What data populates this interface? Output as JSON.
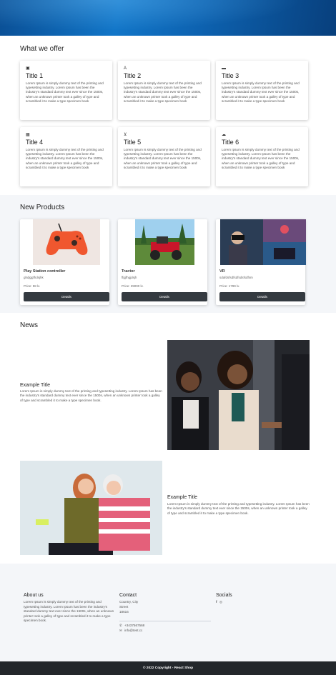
{
  "offer": {
    "heading": "What we offer",
    "cards": [
      {
        "icon": "book-icon",
        "glyph": "▣",
        "title": "Title 1",
        "text": "Lorem Ipsum is simply dummy text of the printing and typesetting industry. Lorem Ipsum has been the industry's standard dummy text ever since the 1500s, when an unknown printer took a galley of type and scrambled it to make a type specimen book"
      },
      {
        "icon": "language-icon",
        "glyph": "A",
        "title": "Title 2",
        "text": "Lorem Ipsum is simply dummy text of the printing and typesetting industry. Lorem Ipsum has been the industry's standard dummy text ever since the 1500s, when an unknown printer took a galley of type and scrambled it to make a type specimen book"
      },
      {
        "icon": "car-icon",
        "glyph": "▬",
        "title": "Title 3",
        "text": "Lorem Ipsum is simply dummy text of the printing and typesetting industry. Lorem Ipsum has been the industry's standard dummy text ever since the 1500s, when an unknown printer took a galley of type and scrambled it to make a type specimen book"
      },
      {
        "icon": "calendar-icon",
        "glyph": "▦",
        "title": "Title 4",
        "text": "Lorem Ipsum is simply dummy text of the printing and typesetting industry. Lorem Ipsum has been the industry's standard dummy text ever since the 1500s, when an unknown printer took a galley of type and scrambled it to make a type specimen book"
      },
      {
        "icon": "cart-icon",
        "glyph": "⊻",
        "title": "Title 5",
        "text": "Lorem Ipsum is simply dummy text of the printing and typesetting industry. Lorem Ipsum has been the industry's standard dummy text ever since the 1500s, when an unknown printer took a galley of type and scrambled it to make a type specimen book"
      },
      {
        "icon": "cloud-icon",
        "glyph": "☁",
        "title": "Title 6",
        "text": "Lorem Ipsum is simply dummy text of the printing and typesetting industry. Lorem Ipsum has been the industry's standard dummy text ever since the 1500s, when an unknown printer took a galley of type and scrambled it to make a type specimen book"
      }
    ]
  },
  "products": {
    "heading": "New Products",
    "items": [
      {
        "name": "Play Station controller",
        "desc": "ghdjggfhdsjhk",
        "price": "Price: 98 lv.",
        "button": "Details"
      },
      {
        "name": "Tractor",
        "desc": "ffgjfhgjdsjh",
        "price": "Price: 29000 lv.",
        "button": "Details"
      },
      {
        "name": "VR",
        "desc": "sdafdsfsdfsdfsdsfsdfsm",
        "price": "Price: 1799 lv.",
        "button": "Details"
      }
    ]
  },
  "news": {
    "heading": "News",
    "items": [
      {
        "title": "Example Title",
        "text": "Lorem Ipsum is simply dummy text of the printing and typesetting industry. Lorem Ipsum has been the industry's standard dummy text ever since the 1500s, when an unknown printer took a galley of type and scrambled it to make a type specimen book."
      },
      {
        "title": "Example Title",
        "text": "Lorem Ipsum is simply dummy text of the printing and typesetting industry. Lorem Ipsum has been the industry's standard dummy text ever since the 1500s, when an unknown printer took a galley of type and scrambled it to make a type specimen book."
      }
    ]
  },
  "footer": {
    "about_heading": "About us",
    "about_text": "Lorem Ipsum is simply dummy text of the printing and typesetting industry. Lorem Ipsum has been the industry's standard dummy text ever since the 1500s, when an unknown printer took a galley of type and scrambled it to make a type specimen book.",
    "contact_heading": "Contact",
    "address_line1": "Country, City",
    "address_line2": "Street",
    "address_line3": "18616",
    "phone": "+3437567568",
    "email": "info@test.cc",
    "socials_heading": "Socials",
    "social_icons": [
      "facebook-icon",
      "instagram-icon"
    ],
    "copyright": "© 2022 Copyright - React Shop"
  },
  "colors": {
    "hero": "#0d62b0",
    "button": "#343a40",
    "band": "#f4f6f9",
    "copyright_bar": "#23272b"
  }
}
